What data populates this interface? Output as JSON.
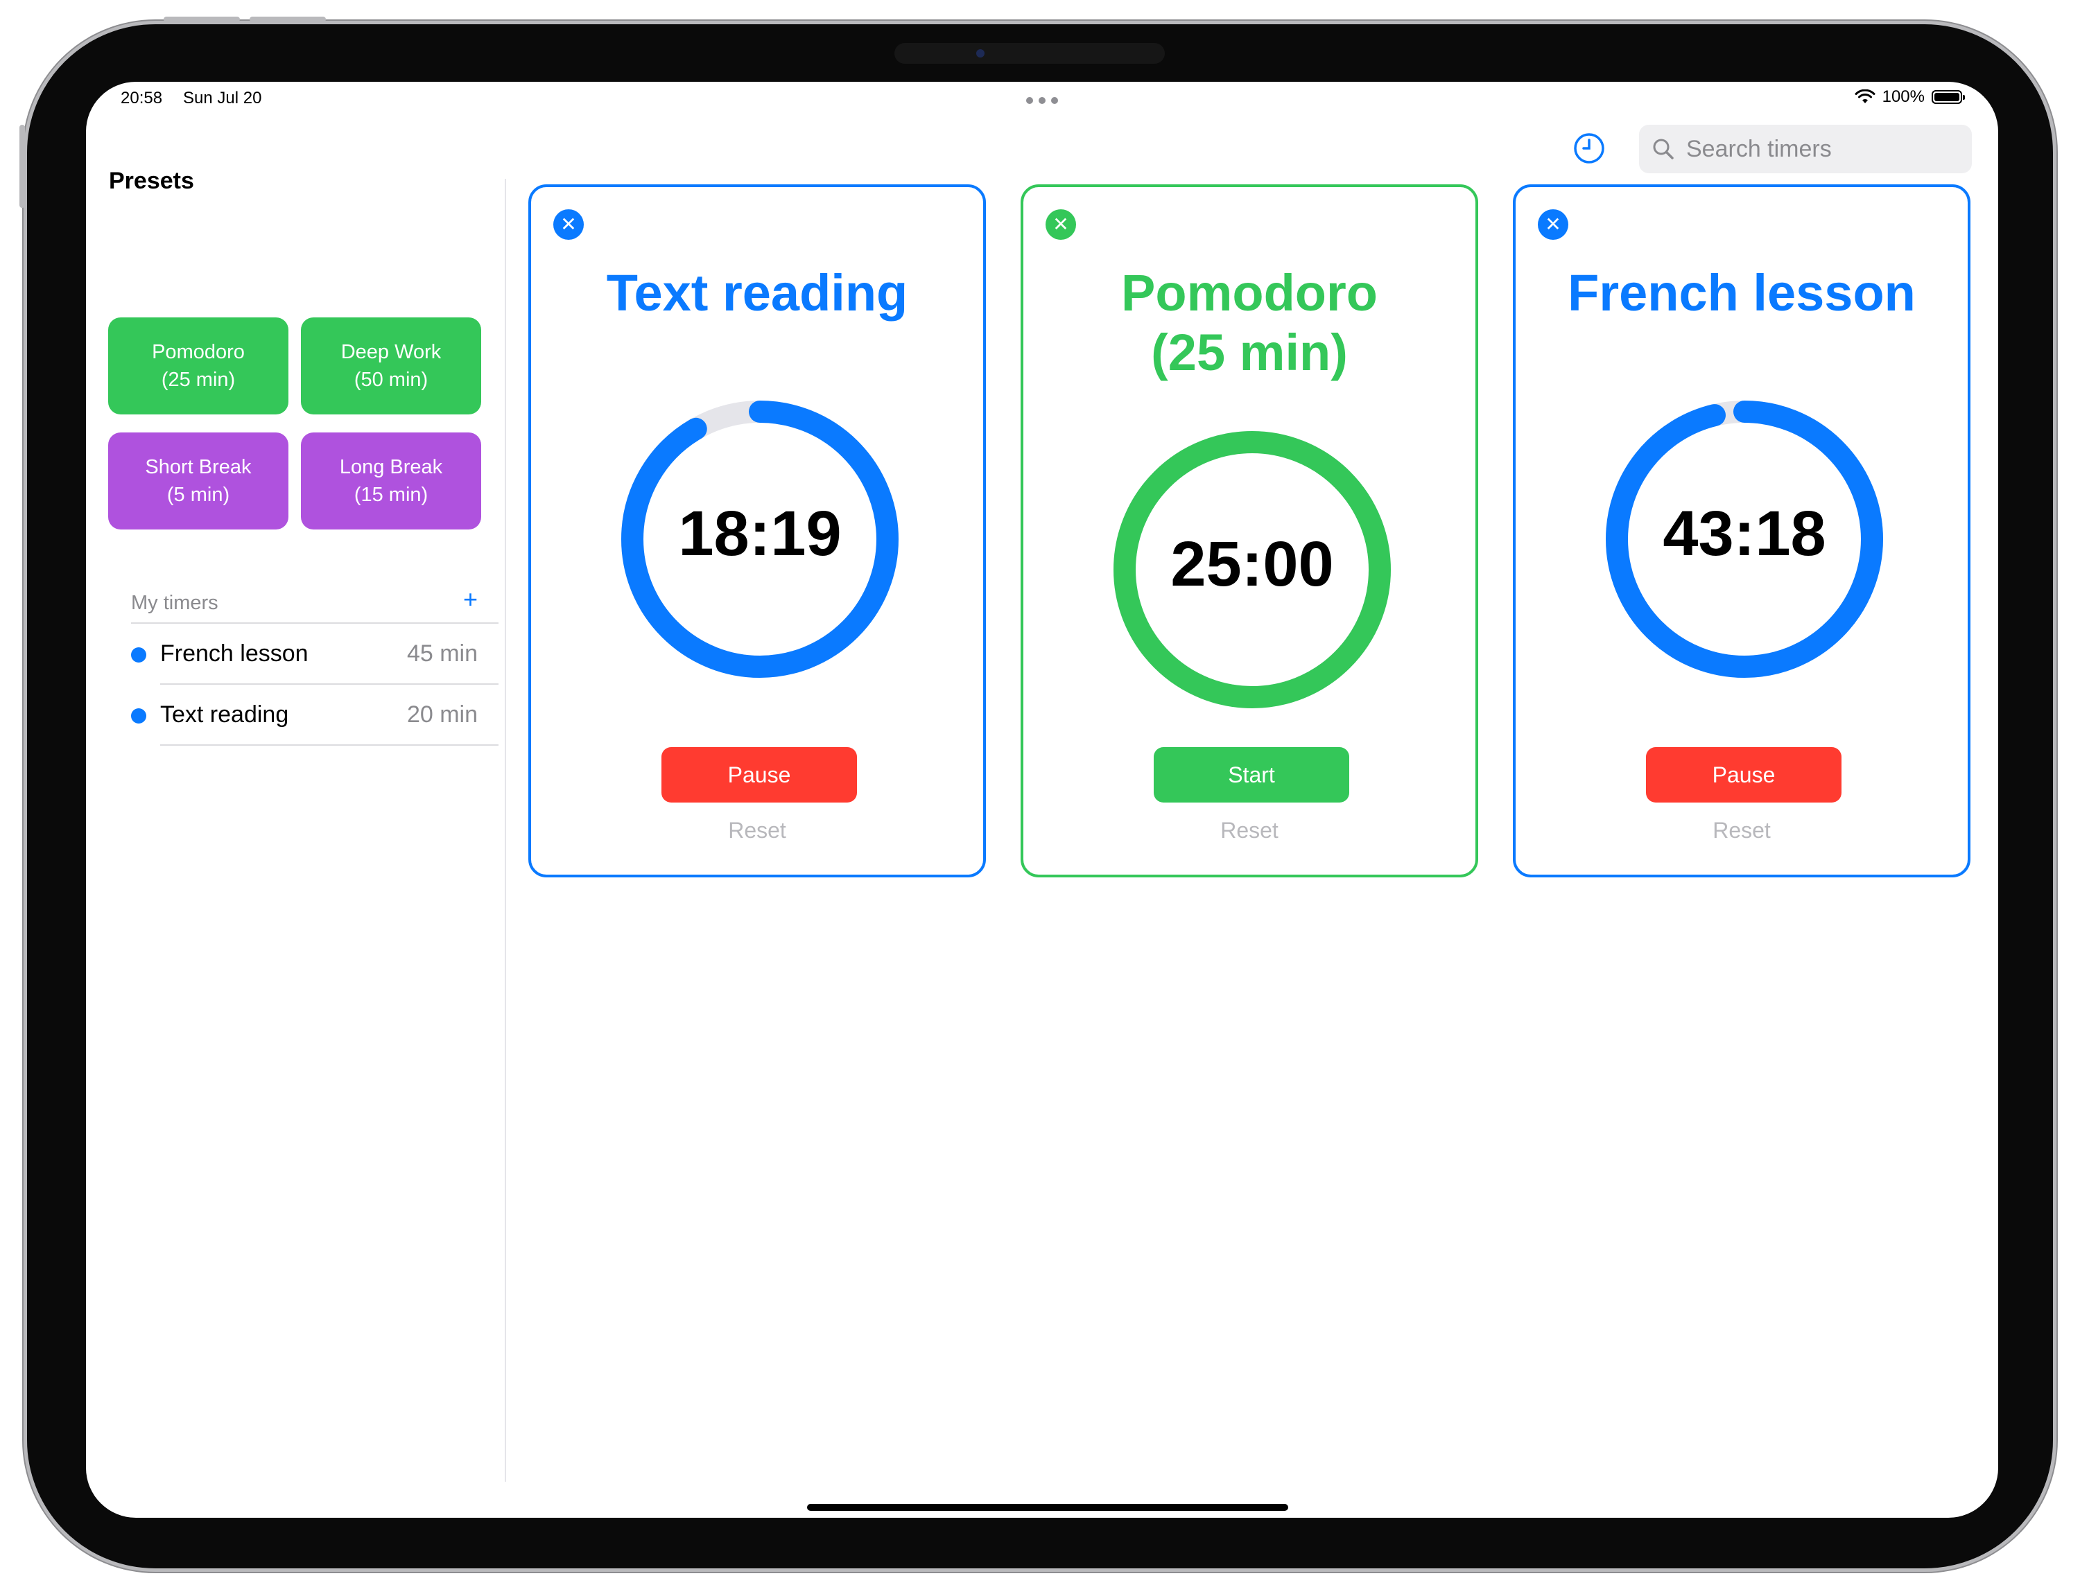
{
  "status_bar": {
    "time": "20:58",
    "date": "Sun Jul 20",
    "battery": "100%",
    "battery_level": 1.0
  },
  "toolbar": {
    "history_icon": "clock-icon",
    "search_placeholder": "Search timers",
    "search_value": ""
  },
  "sidebar": {
    "presets_title": "Presets",
    "presets": [
      {
        "line1": "Pomodoro",
        "line2": "(25 min)",
        "color": "#34c759"
      },
      {
        "line1": "Deep Work",
        "line2": "(50 min)",
        "color": "#34c759"
      },
      {
        "line1": "Short Break",
        "line2": "(5 min)",
        "color": "#af52de"
      },
      {
        "line1": "Long Break",
        "line2": "(15 min)",
        "color": "#af52de"
      }
    ],
    "my_timers_label": "My timers",
    "add_label": "+",
    "my_timers": [
      {
        "name": "French lesson",
        "duration": "45 min"
      },
      {
        "name": "Text reading",
        "duration": "20 min"
      }
    ]
  },
  "cards": [
    {
      "title": "Text reading",
      "time": "18:19",
      "progress": 0.916,
      "color": "#0a7aff",
      "action": "Pause",
      "action_color": "#ff3b30",
      "reset": "Reset"
    },
    {
      "title_line1": "Pomodoro",
      "title_line2": "(25 min)",
      "time": "25:00",
      "progress": 1.0,
      "color": "#34c759",
      "action": "Start",
      "action_color": "#34c759",
      "reset": "Reset"
    },
    {
      "title": "French lesson",
      "time": "43:18",
      "progress": 0.962,
      "color": "#0a7aff",
      "action": "Pause",
      "action_color": "#ff3b30",
      "reset": "Reset"
    }
  ],
  "colors": {
    "accent": "#0a7aff",
    "green": "#34c759",
    "purple": "#af52de",
    "red": "#ff3b30",
    "track": "#e5e5ea"
  }
}
